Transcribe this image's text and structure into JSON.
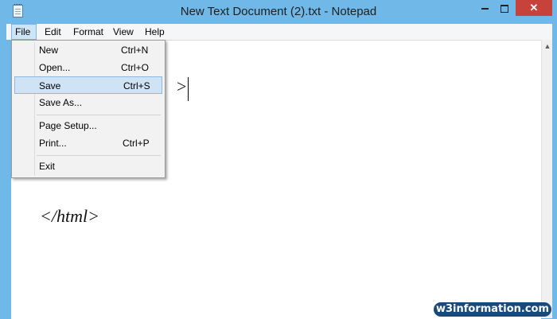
{
  "window": {
    "title": "New Text Document (2).txt - Notepad",
    "close_glyph": "✕",
    "accent_color": "#6fb8e8",
    "close_color": "#c7423a"
  },
  "menubar": {
    "items": [
      {
        "label": "File",
        "selected": true
      },
      {
        "label": "Edit"
      },
      {
        "label": "Format"
      },
      {
        "label": "View"
      },
      {
        "label": "Help"
      }
    ]
  },
  "file_menu": {
    "items": [
      {
        "label": "New",
        "shortcut": "Ctrl+N"
      },
      {
        "label": "Open...",
        "shortcut": "Ctrl+O"
      },
      {
        "label": "Save",
        "shortcut": "Ctrl+S",
        "highlighted": true
      },
      {
        "label": "Save As...",
        "shortcut": ""
      },
      {
        "label": "Page Setup...",
        "shortcut": ""
      },
      {
        "label": "Print...",
        "shortcut": "Ctrl+P"
      },
      {
        "label": "Exit",
        "shortcut": ""
      }
    ]
  },
  "editor": {
    "visible_fragment_1": ">",
    "visible_fragment_2": "</html>"
  },
  "scrollbar": {
    "up_arrow": "▲"
  },
  "watermark": {
    "text": "w3information.com"
  }
}
